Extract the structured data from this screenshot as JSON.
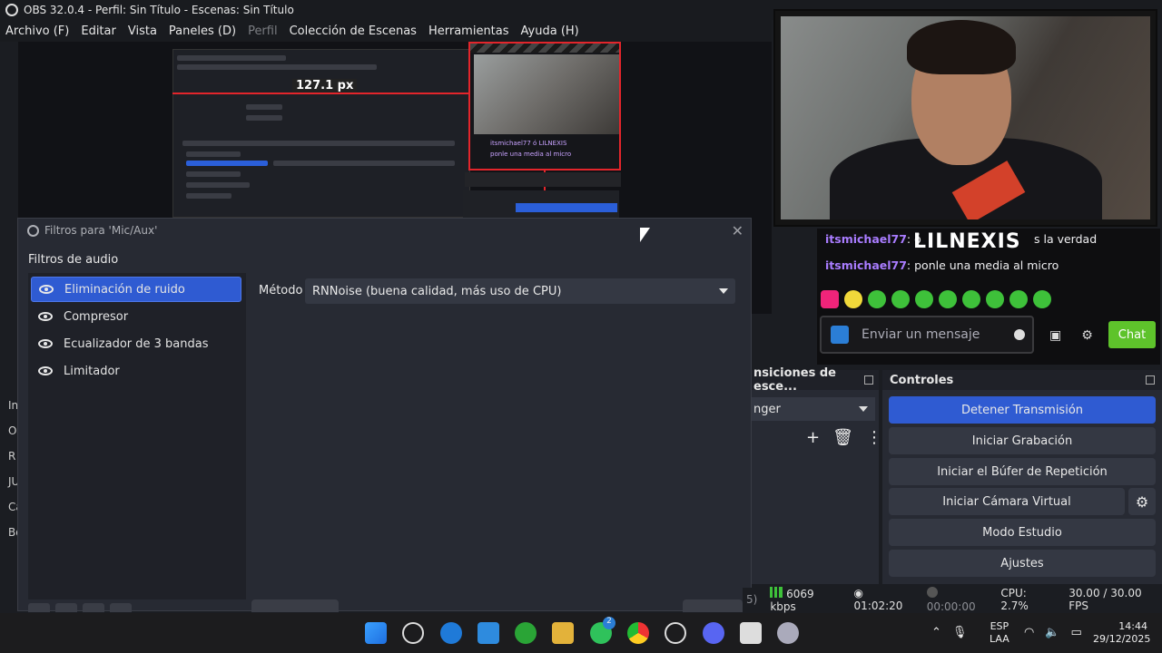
{
  "window": {
    "title": "OBS 32.0.4 - Perfil: Sin Título - Escenas: Sin Título"
  },
  "menu": {
    "items": [
      "Archivo (F)",
      "Editar",
      "Vista",
      "Paneles (D)",
      "Perfil",
      "Colección de Escenas",
      "Herramientas",
      "Ayuda (H)"
    ]
  },
  "preview": {
    "measure_label": "127.1 px"
  },
  "dialog": {
    "title": "Filtros para 'Mic/Aux'",
    "section": "Filtros de audio",
    "filters": [
      "Eliminación de ruido",
      "Compresor",
      "Ecualizador de 3 bandas",
      "Limitador"
    ],
    "method_label": "Método",
    "method_value": "RNNoise (buena calidad, más uso de CPU)"
  },
  "left_strip": [
    "In",
    "O",
    "R",
    "JU",
    "Ca",
    "Bo"
  ],
  "chat": {
    "overlay_name": "LILNEXIS",
    "messages": [
      {
        "user": "itsmichael77",
        "text": ": ó",
        "tail": "s la verdad"
      },
      {
        "user": "itsmichael77",
        "text": ": ponle una media al micro"
      }
    ],
    "input_placeholder": "Enviar un mensaje",
    "send_label": "Chat"
  },
  "transitions": {
    "title": "nsiciones de esce...",
    "selected": "nger"
  },
  "controls": {
    "title": "Controles",
    "buttons": [
      "Detener Transmisión",
      "Iniciar Grabación",
      "Iniciar el Búfer de Repetición",
      "Iniciar Cámara Virtual",
      "Modo Estudio",
      "Ajustes"
    ]
  },
  "status": {
    "left_fragment": "5)",
    "bitrate": "6069 kbps",
    "stream_time": "01:02:20",
    "rec_time": "00:00:00",
    "cpu": "CPU: 2.7%",
    "fps": "30.00 / 30.00 FPS"
  },
  "taskbar": {
    "lang_top": "ESP",
    "lang_bottom": "LAA",
    "time": "14:44",
    "date": "29/12/2025",
    "badge": "2"
  },
  "colors": {
    "accent": "#2f5bd2",
    "twitch_purple": "#a97cff",
    "chat_green": "#5ec32b",
    "guide_red": "#e3252b"
  }
}
